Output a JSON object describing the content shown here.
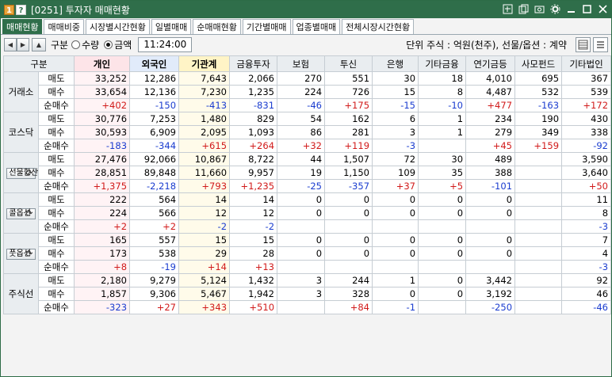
{
  "window": {
    "code": "[0251]",
    "title": "투자자 매매현황",
    "badge1": "1",
    "badge2": "?"
  },
  "tabs": [
    "매매현황",
    "매매비중",
    "시장별시간현황",
    "일별매매",
    "순매매현황",
    "기간별매매",
    "업종별매매",
    "전체시장시간현황"
  ],
  "controls": {
    "gubun_label": "구분",
    "opt_qty": "수량",
    "opt_amt": "금액",
    "selected": "금액",
    "time": "11:24:00",
    "unit": "단위 주식 : 억원(천주), 선물/옵션 : 계약"
  },
  "columns": [
    "구분",
    "개인",
    "외국인",
    "기관계",
    "금융투자",
    "보험",
    "투신",
    "은행",
    "기타금융",
    "연기금등",
    "사모펀드",
    "기타법인"
  ],
  "row_labels": [
    "매도",
    "매수",
    "순매수"
  ],
  "groups": [
    {
      "name": "거래소",
      "button": false,
      "rows": [
        [
          "33,252",
          "12,286",
          "7,643",
          "2,066",
          "270",
          "551",
          "30",
          "18",
          "4,010",
          "695",
          "367"
        ],
        [
          "33,654",
          "12,136",
          "7,230",
          "1,235",
          "224",
          "726",
          "15",
          "8",
          "4,487",
          "532",
          "539"
        ],
        [
          "+402",
          "-150",
          "-413",
          "-831",
          "-46",
          "+175",
          "-15",
          "-10",
          "+477",
          "-163",
          "+172"
        ]
      ]
    },
    {
      "name": "코스닥",
      "button": false,
      "rows": [
        [
          "30,776",
          "7,253",
          "1,480",
          "829",
          "54",
          "162",
          "6",
          "1",
          "234",
          "190",
          "430"
        ],
        [
          "30,593",
          "6,909",
          "2,095",
          "1,093",
          "86",
          "281",
          "3",
          "1",
          "279",
          "349",
          "338"
        ],
        [
          "-183",
          "-344",
          "+615",
          "+264",
          "+32",
          "+119",
          "-3",
          "",
          "+45",
          "+159",
          "-92"
        ]
      ]
    },
    {
      "name": "선물합산",
      "button": true,
      "rows": [
        [
          "27,476",
          "92,066",
          "10,867",
          "8,722",
          "44",
          "1,507",
          "72",
          "30",
          "489",
          "",
          "3,590"
        ],
        [
          "28,851",
          "89,848",
          "11,660",
          "9,957",
          "19",
          "1,150",
          "109",
          "35",
          "388",
          "",
          "3,640"
        ],
        [
          "+1,375",
          "-2,218",
          "+793",
          "+1,235",
          "-25",
          "-357",
          "+37",
          "+5",
          "-101",
          "",
          "+50"
        ]
      ]
    },
    {
      "name": "콜옵션",
      "button": true,
      "rows": [
        [
          "222",
          "564",
          "14",
          "14",
          "0",
          "0",
          "0",
          "0",
          "0",
          "",
          "11"
        ],
        [
          "224",
          "566",
          "12",
          "12",
          "0",
          "0",
          "0",
          "0",
          "0",
          "",
          "8"
        ],
        [
          "+2",
          "+2",
          "-2",
          "-2",
          "",
          "",
          "",
          "",
          "",
          "",
          "-3"
        ]
      ]
    },
    {
      "name": "풋옵션",
      "button": true,
      "rows": [
        [
          "165",
          "557",
          "15",
          "15",
          "0",
          "0",
          "0",
          "0",
          "0",
          "",
          "7"
        ],
        [
          "173",
          "538",
          "29",
          "28",
          "0",
          "0",
          "0",
          "0",
          "0",
          "",
          "4"
        ],
        [
          "+8",
          "-19",
          "+14",
          "+13",
          "",
          "",
          "",
          "",
          "",
          "",
          "-3"
        ]
      ]
    },
    {
      "name": "주식선",
      "button": false,
      "rows": [
        [
          "2,180",
          "9,279",
          "5,124",
          "1,432",
          "3",
          "244",
          "1",
          "0",
          "3,442",
          "",
          "92"
        ],
        [
          "1,857",
          "9,306",
          "5,467",
          "1,942",
          "3",
          "328",
          "0",
          "0",
          "3,192",
          "",
          "46"
        ],
        [
          "-323",
          "+27",
          "+343",
          "+510",
          "",
          "+84",
          "-1",
          "",
          "-250",
          "",
          "-46"
        ]
      ]
    }
  ]
}
